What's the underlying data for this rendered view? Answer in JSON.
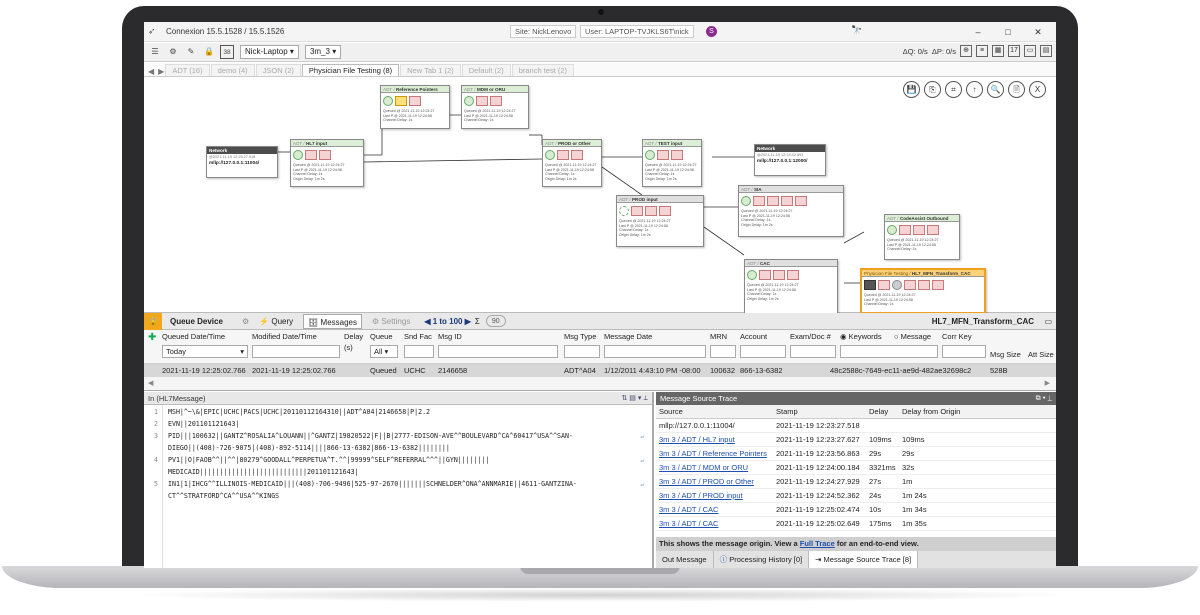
{
  "window": {
    "title": "Connexion 15.5.1528 / 15.5.1526",
    "site": "Site: NickLenovo",
    "user": "User: LAPTOP-TVJKLS6T\\nick",
    "user_badge": "S",
    "minimize": "–",
    "maximize": "□",
    "close": "✕"
  },
  "toolbar": {
    "device_select": "Nick-Laptop",
    "group_select": "3m_3",
    "counter_badge": "38",
    "dq": "ΔQ: 0/s",
    "dp": "ΔP: 0/s",
    "dates": "17"
  },
  "tabs": [
    {
      "label": "ADT (16)",
      "active": false
    },
    {
      "label": "demo (4)",
      "active": false
    },
    {
      "label": "JSON (2)",
      "active": false
    },
    {
      "label": "Physician File Testing (8)",
      "active": true
    },
    {
      "label": "New Tab 1 (2)",
      "active": false
    },
    {
      "label": "Default (2)",
      "active": false
    },
    {
      "label": "branch test (2)",
      "active": false
    }
  ],
  "canvas": {
    "tools": [
      "💾",
      "⎘",
      "⌗",
      "↑",
      "🔍",
      "🗎",
      "X"
    ],
    "network_in": {
      "title": "Network",
      "date": "@2021-11-19 12:25:27.518",
      "addr": "mllp://127.0.0.1:11004/"
    },
    "network_out": {
      "title": "Network",
      "date": "@2021-11-19 12:24:42.593",
      "addr": "mllp://127.0.0.1:12000/"
    },
    "nodes": [
      {
        "pre": "ADT / ",
        "name": "HL7 input",
        "style": "green"
      },
      {
        "pre": "ADT / ",
        "name": "Reference Pointers",
        "style": "green"
      },
      {
        "pre": "ADT / ",
        "name": "MDM or ORU",
        "style": "green"
      },
      {
        "pre": "ADT / ",
        "name": "PROD or Other",
        "style": "green"
      },
      {
        "pre": "ADT / ",
        "name": "TEST input",
        "style": "green"
      },
      {
        "pre": "ADT / ",
        "name": "PROD input",
        "style": ""
      },
      {
        "pre": "ADT / ",
        "name": "SIA",
        "style": ""
      },
      {
        "pre": "ADT / ",
        "name": "CodeAssist Outbound",
        "style": "green"
      },
      {
        "pre": "ADT / ",
        "name": "CAC",
        "style": ""
      },
      {
        "pre": "Physician File Testing / ",
        "name": "HL7_MFN_Transform_CAC",
        "style": "orange"
      }
    ],
    "node_lines": [
      "Queued @ 2021-11-19 12:24:27",
      "Last P @ 2021-11-19 12:24:58",
      "Channel Delay: 1s",
      "Origin Delay: 1m 2s"
    ]
  },
  "queue": {
    "lock_icon": "🔒",
    "title": "Queue Device",
    "query_label": "Query",
    "messages_label": "Messages",
    "settings_label": "Settings",
    "range": "1 to 100",
    "count": "90",
    "device_name": "HL7_MFN_Transform_CAC",
    "columns": {
      "queued_date": "Queued Date/Time",
      "modified_date": "Modified Date/Time",
      "delay": "Delay",
      "delay_unit": "(s)",
      "queue": "Queue",
      "snd_fac": "Snd Fac",
      "msg_id": "Msg ID",
      "msg_type": "Msg Type",
      "message_date": "Message Date",
      "mrn": "MRN",
      "account": "Account",
      "exam_doc": "Exam/Doc #",
      "keywords": "Keywords",
      "message": "Message",
      "corr_key": "Corr Key",
      "msg_size": "Msg Size",
      "att_size": "Att Size"
    },
    "filters": {
      "queued_date": "Today",
      "queue": "All"
    },
    "row": {
      "queued": "2021-11-19 12:25:02.766",
      "modified": "2021-11-19 12:25:02.766",
      "queue": "Queued",
      "snd_fac": "UCHC",
      "msg_id": "2146658",
      "msg_type": "ADT^A04",
      "message_date": "1/12/2011 4:43:10 PM -08:00",
      "mrn": "100632",
      "account": "866-13-6382",
      "corr_key": "48c2588c-7649-ec11-ae9d-482ae32698c2",
      "msg_size": "528B"
    }
  },
  "hl7": {
    "title": "In (HL7Message)",
    "lines": [
      {
        "n": "1",
        "text": "MSH|^~\\&|EPIC|UCHC|PACS|UCHC|20110112164310||ADT^A04|2146658|P|2.2"
      },
      {
        "n": "2",
        "text": "EVN||201101121643|"
      },
      {
        "n": "3",
        "text": "PID|||100632||GANTZ^ROSALIA^LOUANN||^GANTZ|19820522|F||B|2777-EDISON-AVE^^BOULEVARD^CA^60417^USA^^SAN-"
      },
      {
        "n": "",
        "text": "DIEGO||(408)-726-9075|(408)-892-5114||||866-13-6382|866-13-6382||||||||"
      },
      {
        "n": "4",
        "text": "PV1||O|FAOB^^||^^|80279^GOODALL^PERPETUA^T.^^|99999^SELF^REFERRAL^^^||GYN||||||||"
      },
      {
        "n": "",
        "text": "MEDICAID|||||||||||||||||||||||||||201101121643|"
      },
      {
        "n": "5",
        "text": "IN1|1|IHCG^^ILLINOIS-MEDICAID|||(408)-706-9496|525-97-2670|||||||SCHNELDER^ONA^ANNMARIE||4611-GANTZINA-"
      },
      {
        "n": "",
        "text": "CT^^STRATFORD^CA^^USA^^KINGS"
      }
    ]
  },
  "trace": {
    "title": "Message Source Trace",
    "headers": {
      "source": "Source",
      "stamp": "Stamp",
      "delay": "Delay",
      "delay_origin": "Delay from Origin"
    },
    "rows": [
      {
        "source": "mllp://127.0.0.1:11004/",
        "stamp": "2021-11-19 12:23:27.518",
        "delay": "",
        "origin": "",
        "link": false
      },
      {
        "source": "3m 3 / ADT / HL7 input",
        "stamp": "2021-11-19 12:23:27.627",
        "delay": "109ms",
        "origin": "109ms",
        "link": true
      },
      {
        "source": "3m 3 / ADT / Reference Pointers",
        "stamp": "2021-11-19 12:23:56.863",
        "delay": "29s",
        "origin": "29s",
        "link": true
      },
      {
        "source": "3m 3 / ADT / MDM or ORU",
        "stamp": "2021-11-19 12:24:00.184",
        "delay": "3321ms",
        "origin": "32s",
        "link": true
      },
      {
        "source": "3m 3 / ADT / PROD or Other",
        "stamp": "2021-11-19 12:24:27.929",
        "delay": "27s",
        "origin": "1m",
        "link": true
      },
      {
        "source": "3m 3 / ADT / PROD input",
        "stamp": "2021-11-19 12:24:52.362",
        "delay": "24s",
        "origin": "1m 24s",
        "link": true
      },
      {
        "source": "3m 3 / ADT / CAC",
        "stamp": "2021-11-19 12:25:02.474",
        "delay": "10s",
        "origin": "1m 34s",
        "link": true
      },
      {
        "source": "3m 3 / ADT / CAC",
        "stamp": "2021-11-19 12:25:02.649",
        "delay": "175ms",
        "origin": "1m 35s",
        "link": true
      }
    ],
    "footer_a": "This shows the message origin. View a ",
    "footer_link": "Full Trace",
    "footer_b": " for an end-to-end view."
  },
  "bottom_tabs": {
    "out": "Out Message",
    "history": "Processing History [0]",
    "trace": "Message Source Trace [8]"
  }
}
